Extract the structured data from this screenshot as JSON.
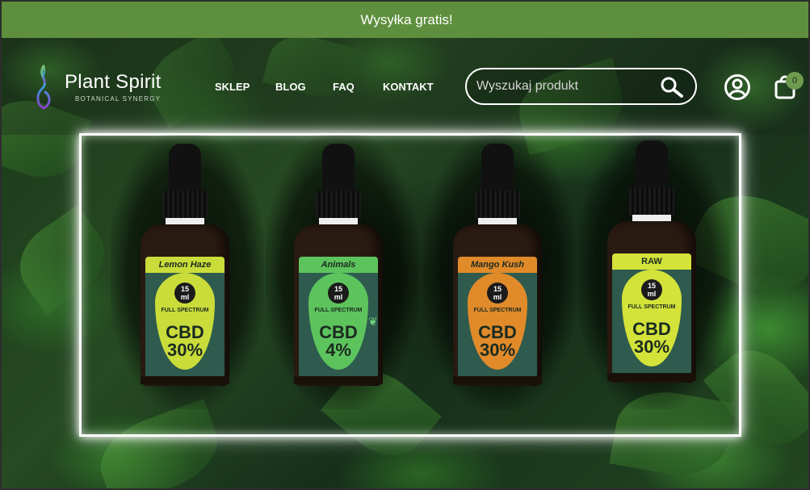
{
  "announcement": {
    "text": "Wysyłka gratis!"
  },
  "brand": {
    "name": "Plant Spirit",
    "tagline": "BOTANICAL SYNERGY"
  },
  "nav": {
    "items": [
      {
        "label": "SKLEP"
      },
      {
        "label": "BLOG"
      },
      {
        "label": "FAQ"
      },
      {
        "label": "KONTAKT"
      }
    ]
  },
  "search": {
    "placeholder": "Wyszukaj produkt",
    "value": ""
  },
  "cart": {
    "count": "0"
  },
  "products": [
    {
      "name": "Lemon Haze",
      "volume": "15",
      "unit": "ml",
      "type": "FULL SPECTRUM",
      "cbd": "CBD",
      "percent": "30%",
      "color": "#c9dc3a"
    },
    {
      "name": "Animals",
      "volume": "15",
      "unit": "ml",
      "type": "FULL SPECTRUM",
      "cbd": "CBD",
      "percent": "4%",
      "color": "#5dc45d"
    },
    {
      "name": "Mango Kush",
      "volume": "15",
      "unit": "ml",
      "type": "FULL SPECTRUM",
      "cbd": "CBD",
      "percent": "30%",
      "color": "#e08a2a"
    },
    {
      "name": "RAW",
      "volume": "15",
      "unit": "ml",
      "type": "FULL SPECTRUM",
      "cbd": "CBD",
      "percent": "30%",
      "color": "#d4e33a"
    }
  ],
  "icons": {
    "search": "search-icon",
    "user": "user-icon",
    "cart": "shopping-bag-icon",
    "paw": "paw-icon"
  },
  "colors": {
    "announcement_bg": "#5e8f3e",
    "frame": "#ffffff",
    "cart_badge": "#6e9a4e"
  }
}
